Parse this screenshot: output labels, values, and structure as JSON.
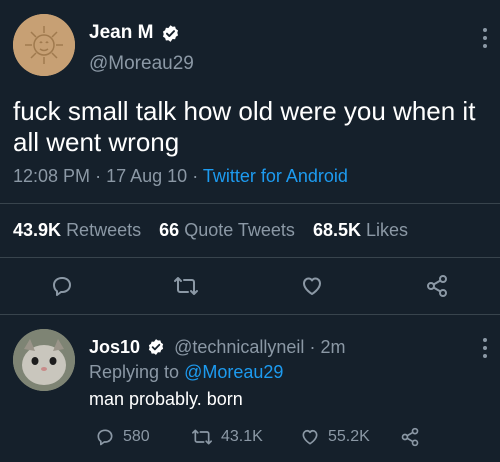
{
  "tweet": {
    "author_name": "Jean M",
    "author_handle": "@Moreau29",
    "text": "fuck small talk how old were you when it all went wrong",
    "time": "12:08 PM",
    "date": "17 Aug 10",
    "source": "Twitter for Android",
    "separator": "·",
    "retweets_count": "43.9K",
    "retweets_label": "Retweets",
    "quote_count": "66",
    "quote_label": "Quote Tweets",
    "likes_count": "68.5K",
    "likes_label": "Likes"
  },
  "reply": {
    "author_name": "Jos10",
    "author_handle": "@technicallyneil",
    "time_ago": "2m",
    "separator": "·",
    "replying_label": "Replying to",
    "replying_handle": "@Moreau29",
    "text": "man probably. born",
    "reply_count": "580",
    "retweet_count": "43.1K",
    "like_count": "55.2K"
  },
  "icons": [
    "verified-badge-icon",
    "more-icon",
    "reply-icon",
    "retweet-icon",
    "like-icon",
    "share-icon"
  ],
  "colors": {
    "background": "#15202b",
    "accent": "#1d9bf0",
    "muted": "#8b98a5",
    "divider": "#38444d"
  }
}
